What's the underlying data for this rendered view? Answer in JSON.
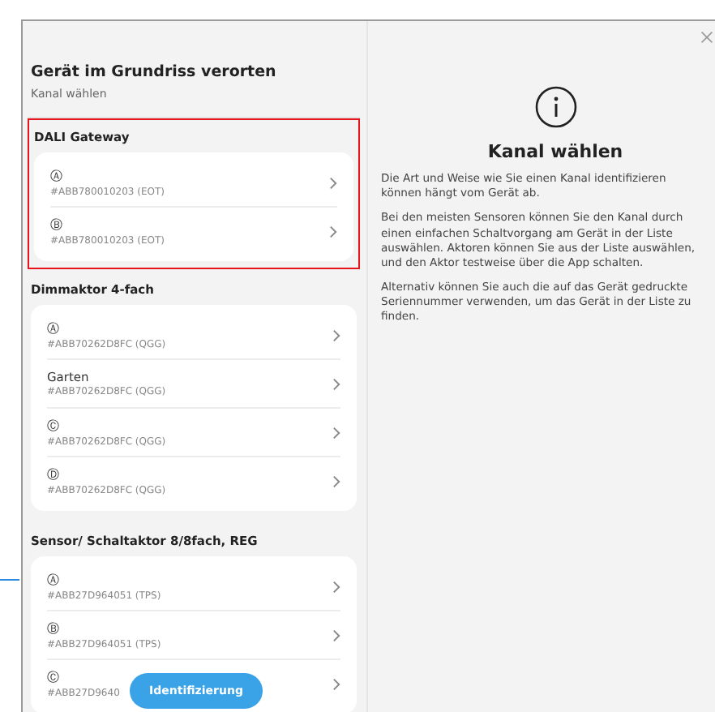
{
  "header": {
    "title": "Gerät im Grundriss verorten",
    "subtitle": "Kanal wählen"
  },
  "sections": [
    {
      "title": "DALI Gateway",
      "highlighted": true,
      "items": [
        {
          "label": "Ⓐ",
          "serial": "#ABB780010203 (EOT)"
        },
        {
          "label": "Ⓑ",
          "serial": "#ABB780010203 (EOT)"
        }
      ]
    },
    {
      "title": "Dimmaktor 4-fach",
      "highlighted": false,
      "items": [
        {
          "label": "Ⓐ",
          "serial": "#ABB70262D8FC (QGG)"
        },
        {
          "label": "Garten",
          "serial": "#ABB70262D8FC (QGG)"
        },
        {
          "label": "Ⓒ",
          "serial": "#ABB70262D8FC (QGG)"
        },
        {
          "label": "Ⓓ",
          "serial": "#ABB70262D8FC (QGG)"
        }
      ]
    },
    {
      "title": "Sensor/ Schaltaktor 8/8fach, REG",
      "highlighted": false,
      "items": [
        {
          "label": "Ⓐ",
          "serial": "#ABB27D964051 (TPS)"
        },
        {
          "label": "Ⓑ",
          "serial": "#ABB27D964051 (TPS)"
        },
        {
          "label": "Ⓒ",
          "serial": "#ABB27D9640"
        }
      ]
    }
  ],
  "floating_button": "Identifizierung",
  "info": {
    "heading": "Kanal wählen",
    "paragraphs": [
      "Die Art und Weise wie Sie einen Kanal identifizieren können hängt vom Gerät ab.",
      "Bei den meisten Sensoren können Sie den Kanal durch einen einfachen Schaltvorgang am Gerät in der Liste auswählen. Aktoren können Sie aus der Liste auswählen, und den Aktor testweise über die App schalten.",
      "Alternativ können Sie auch die auf das Gerät gedruckte Seriennummer verwenden, um das Gerät in der Liste zu finden."
    ]
  }
}
